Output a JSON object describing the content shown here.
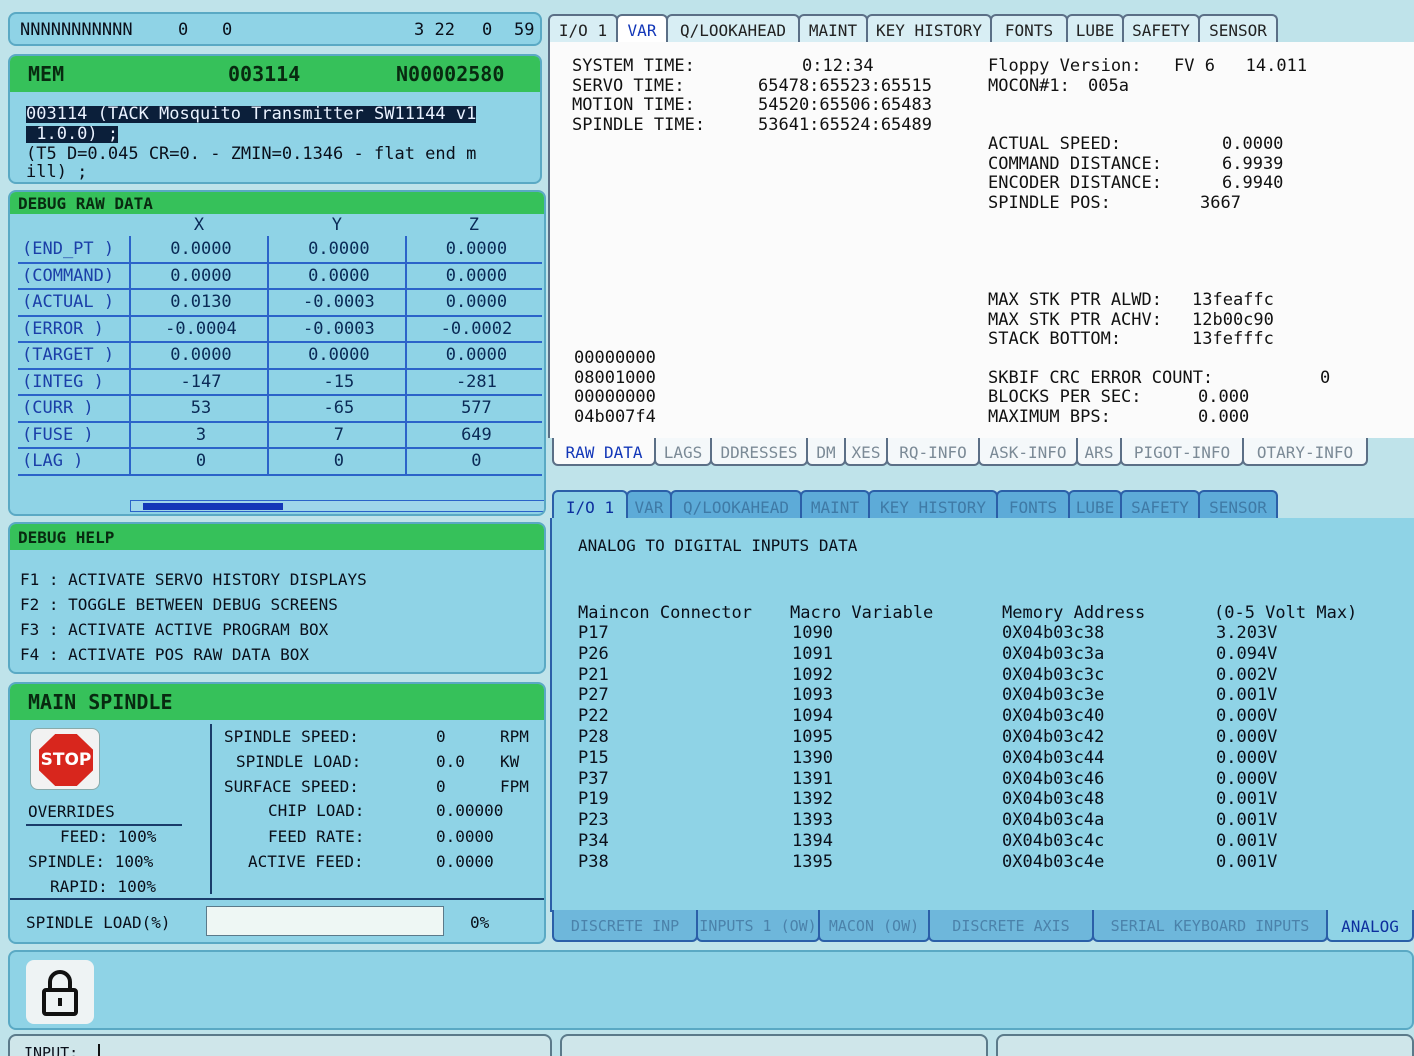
{
  "status_bar": {
    "name": "NNNNNNNNNNN",
    "v1": "0",
    "v2": "0",
    "v3": "3 22",
    "v4": "0",
    "v5": "59"
  },
  "program": {
    "mode": "MEM",
    "prog_num": "003114",
    "seq_num": "N00002580",
    "line1": "003114 (TACK Mosquito Transmitter SW11144 v1",
    "line1b": " 1.0.0) ;",
    "line2": "(T5 D=0.045 CR=0. - ZMIN=0.1346 - flat end m",
    "line3": "ill) ;"
  },
  "debug_raw": {
    "title": "DEBUG RAW DATA",
    "columns": [
      "X",
      "Y",
      "Z"
    ],
    "rows": [
      {
        "label": "(END_PT )",
        "x": "0.0000",
        "y": "0.0000",
        "z": "0.0000"
      },
      {
        "label": "(COMMAND)",
        "x": "0.0000",
        "y": "0.0000",
        "z": "0.0000"
      },
      {
        "label": "(ACTUAL )",
        "x": "0.0130",
        "y": "-0.0003",
        "z": "0.0000"
      },
      {
        "label": "(ERROR  )",
        "x": "-0.0004",
        "y": "-0.0003",
        "z": "-0.0002"
      },
      {
        "label": "(TARGET )",
        "x": "0.0000",
        "y": "0.0000",
        "z": "0.0000"
      },
      {
        "label": "(INTEG  )",
        "x": "-147",
        "y": "-15",
        "z": "-281"
      },
      {
        "label": "(CURR   )",
        "x": "53",
        "y": "-65",
        "z": "577"
      },
      {
        "label": "(FUSE   )",
        "x": "3",
        "y": "7",
        "z": "649"
      },
      {
        "label": "(LAG    )",
        "x": "0",
        "y": "0",
        "z": "0"
      }
    ]
  },
  "debug_help": {
    "title": "DEBUG HELP",
    "items": [
      "F1 : ACTIVATE SERVO HISTORY DISPLAYS",
      "F2 : TOGGLE BETWEEN DEBUG SCREENS",
      "F3 : ACTIVATE ACTIVE PROGRAM BOX",
      "F4 : ACTIVATE POS RAW DATA BOX"
    ]
  },
  "spindle": {
    "title": "MAIN SPINDLE",
    "stop_label": "STOP",
    "overrides_title": "OVERRIDES",
    "feed": "FEED: 100%",
    "spindle": "SPINDLE: 100%",
    "rapid": "RAPID: 100%",
    "speed_label": "SPINDLE SPEED:",
    "speed_val": "0",
    "speed_unit": "RPM",
    "load_label": "SPINDLE LOAD:",
    "load_val": "0.0",
    "load_unit": "KW",
    "surf_label": "SURFACE SPEED:",
    "surf_val": "0",
    "surf_unit": "FPM",
    "chip_label": "CHIP LOAD:",
    "chip_val": "0.00000",
    "feedrate_label": "FEED RATE:",
    "feedrate_val": "0.0000",
    "active_label": "ACTIVE FEED:",
    "active_val": "0.0000",
    "loadpct_label": "SPINDLE LOAD(%)",
    "loadpct_val": "0%",
    "load_fraction": 0.0
  },
  "tabs_top": [
    "I/O 1",
    "VAR",
    "Q/LOOKAHEAD",
    "MAINT",
    "KEY HISTORY",
    "FONTS",
    "LUBE",
    "SAFETY",
    "SENSOR"
  ],
  "var": {
    "sys_label": "SYSTEM TIME:",
    "sys_val": "0:12:34",
    "servo_label": "SERVO TIME:",
    "servo_val": "65478:65523:65515",
    "motion_label": "MOTION TIME:",
    "motion_val": "54520:65506:65483",
    "spindle_label": "SPINDLE TIME:",
    "spindle_val": "53641:65524:65489",
    "floppy_label": "Floppy Version:",
    "floppy_val": "FV 6   14.011",
    "mocon_label": "MOCON#1:",
    "mocon_val": "005a",
    "act_label": "ACTUAL SPEED:",
    "act_val": "0.0000",
    "cmd_label": "COMMAND DISTANCE:",
    "cmd_val": "6.9939",
    "enc_label": "ENCODER DISTANCE:",
    "enc_val": "6.9940",
    "spos_label": "SPINDLE POS:",
    "spos_val": "3667",
    "maxalwd_label": "MAX STK PTR ALWD:",
    "maxalwd_val": "13feaffc",
    "maxachv_label": "MAX STK PTR ACHV:",
    "maxachv_val": "12b00c90",
    "stkbot_label": "STACK BOTTOM:",
    "stkbot_val": "13fefffc",
    "hex": [
      "00000000",
      "08001000",
      "00000000",
      "04b007f4"
    ],
    "crc_label": "SKBIF CRC ERROR COUNT:",
    "crc_val": "0",
    "bps_label": "BLOCKS PER SEC:",
    "bps_val": "0.000",
    "maxbps_label": "MAXIMUM BPS:",
    "maxbps_val": "0.000"
  },
  "tabs_var_bottom": [
    "RAW DATA",
    "LAGS",
    "DDRESSES",
    "DM",
    "XES",
    "RQ-INFO",
    "ASK-INFO",
    "ARS",
    "PIGOT-INFO",
    "OTARY-INFO"
  ],
  "tabs_mid": [
    "I/O 1",
    "VAR",
    "Q/LOOKAHEAD",
    "MAINT",
    "KEY HISTORY",
    "FONTS",
    "LUBE",
    "SAFETY",
    "SENSOR"
  ],
  "analog": {
    "title": "ANALOG TO DIGITAL INPUTS DATA",
    "headers": [
      "Maincon Connector",
      "Macro Variable",
      "Memory Address",
      "(0-5 Volt Max)"
    ],
    "rows": [
      [
        "P17",
        "1090",
        "0X04b03c38",
        "3.203V"
      ],
      [
        "P26",
        "1091",
        "0X04b03c3a",
        "0.094V"
      ],
      [
        "P21",
        "1092",
        "0X04b03c3c",
        "0.002V"
      ],
      [
        "P27",
        "1093",
        "0X04b03c3e",
        "0.001V"
      ],
      [
        "P22",
        "1094",
        "0X04b03c40",
        "0.000V"
      ],
      [
        "P28",
        "1095",
        "0X04b03c42",
        "0.000V"
      ],
      [
        "P15",
        "1390",
        "0X04b03c44",
        "0.000V"
      ],
      [
        "P37",
        "1391",
        "0X04b03c46",
        "0.000V"
      ],
      [
        "P19",
        "1392",
        "0X04b03c48",
        "0.001V"
      ],
      [
        "P23",
        "1393",
        "0X04b03c4a",
        "0.001V"
      ],
      [
        "P34",
        "1394",
        "0X04b03c4c",
        "0.001V"
      ],
      [
        "P38",
        "1395",
        "0X04b03c4e",
        "0.001V"
      ]
    ]
  },
  "tabs_analog_bottom": [
    "DISCRETE INP",
    "INPUTS 1 (OW)",
    "MACON (OW)",
    "DISCRETE AXIS",
    "SERIAL KEYBOARD INPUTS",
    "ANALOG"
  ],
  "input": {
    "label": "INPUT:"
  }
}
